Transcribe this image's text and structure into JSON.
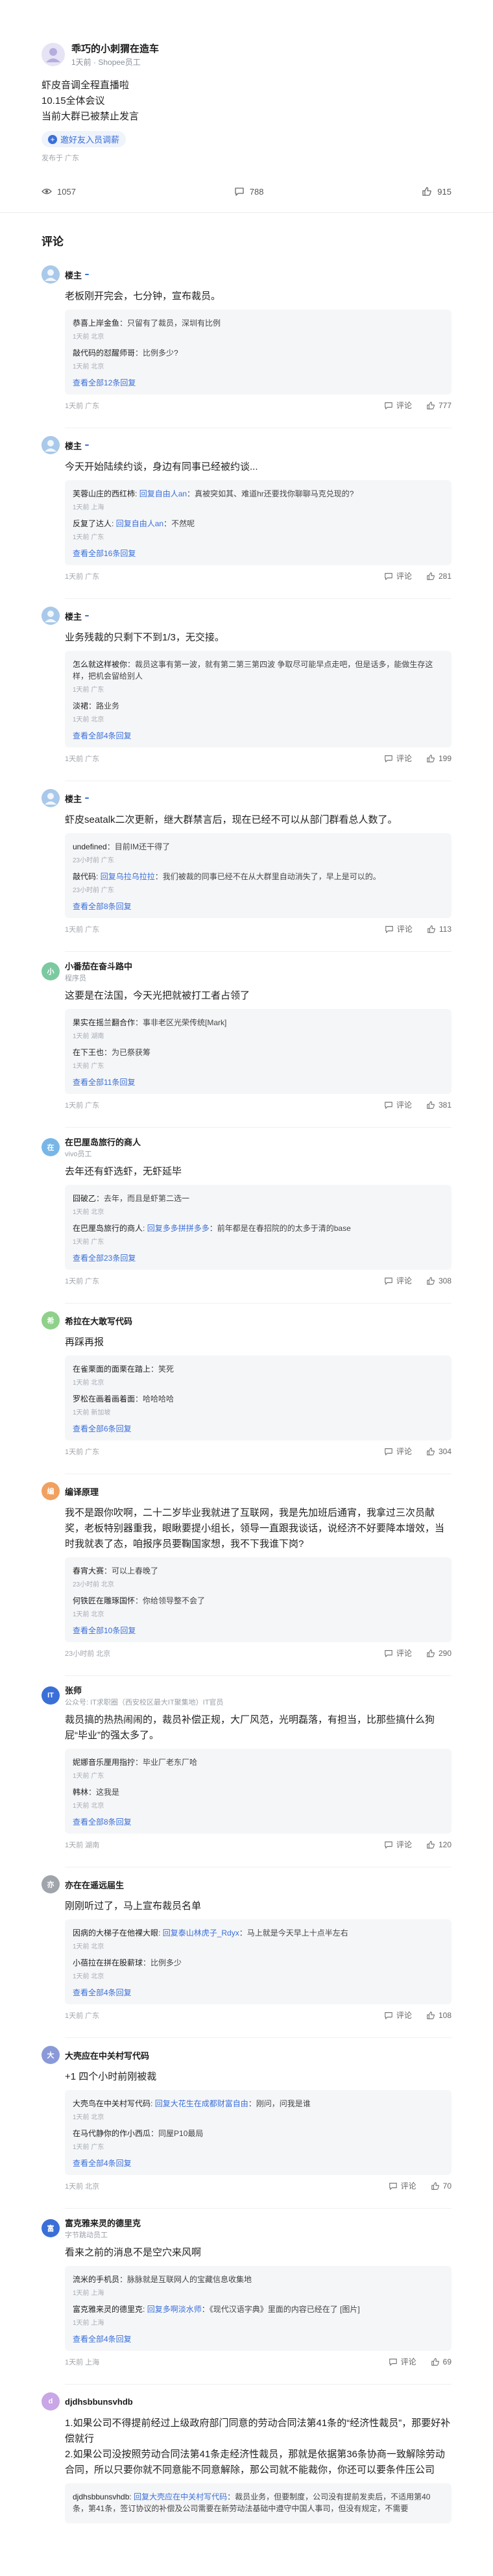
{
  "post": {
    "author": "乖巧的小刺猬在造车",
    "author_sub": "1天前 · Shopee员工",
    "lines": [
      "虾皮音调全程直播啦",
      "10.15全体会议",
      "当前大群已被禁止发言"
    ],
    "invite_label": "邀好友入员调薪",
    "meta": "发布于 广东",
    "stats": {
      "views": "1057",
      "comments": "788",
      "likes": "915"
    }
  },
  "comments_title": "评论",
  "comments": [
    {
      "name": "楼主",
      "op": true,
      "sub": "",
      "avatar_color": "#9cc2e6",
      "avatar_char": "",
      "text": [
        "老板刚开完会，七分钟，宣布裁员。"
      ],
      "replies": [
        {
          "author": "恭喜上岸金鱼",
          "to": "",
          "text": "只留有了裁员，深圳有比例",
          "meta": "1天前 北京"
        },
        {
          "author": "敲代码的怼醒师哥",
          "to": "",
          "text": "比例多少?",
          "meta": "1天前 北京"
        }
      ],
      "more": "查看全部12条回复",
      "meta": "1天前 广东",
      "comments": "评论",
      "likes": "777"
    },
    {
      "name": "楼主",
      "op": true,
      "sub": "",
      "avatar_color": "#9cc2e6",
      "avatar_char": "",
      "text": [
        "今天开始陆续约谈，身边有同事已经被约谈..."
      ],
      "replies": [
        {
          "author": "芙蓉山庄的西红柿",
          "to": "回复自由人an",
          "text": "真被突如其、难道hr还要找你聊聊马克兑现的?",
          "meta": "1天前 上海"
        },
        {
          "author": "反复了达人",
          "to": "回复自由人an",
          "text": "不然呢",
          "meta": "1天前 广东"
        }
      ],
      "more": "查看全部16条回复",
      "meta": "1天前 广东",
      "comments": "评论",
      "likes": "281"
    },
    {
      "name": "楼主",
      "op": true,
      "sub": "",
      "avatar_color": "#9cc2e6",
      "avatar_char": "",
      "text": [
        "业务残裁的只剩下不到1/3，无交接。"
      ],
      "replies": [
        {
          "author": "怎么就这样被你",
          "to": "",
          "text": "裁员这事有第一波，就有第二第三第四波 争取尽可能早点走吧，但是话多，能做生存这样，把机会留给别人",
          "meta": "1天前 广东"
        },
        {
          "author": "淡裙",
          "to": "",
          "text": "路业务",
          "meta": "1天前 北京"
        }
      ],
      "more": "查看全部4条回复",
      "meta": "1天前 广东",
      "comments": "评论",
      "likes": "199"
    },
    {
      "name": "楼主",
      "op": true,
      "sub": "",
      "avatar_color": "#9cc2e6",
      "avatar_char": "",
      "text": [
        "虾皮seatalk二次更新，继大群禁言后，现在已经不可以从部门群看总人数了。"
      ],
      "replies": [
        {
          "author": "undefined",
          "to": "",
          "text": "目前IM还干得了",
          "meta": "23小时前 广东"
        },
        {
          "author": "敲代码",
          "to": "回复乌拉乌拉拉",
          "text": "我们被裁的同事已经不在从大群里自动消失了，早上是可以的。",
          "meta": "23小时前 广东"
        }
      ],
      "more": "查看全部8条回复",
      "meta": "1天前 广东",
      "comments": "评论",
      "likes": "113"
    },
    {
      "name": "小番茄在奋斗路中",
      "op": false,
      "sub": "程序员",
      "avatar_color": "#7bc9a0",
      "avatar_char": "小",
      "text": [
        "这要是在法国，今天光把就被打工者占领了"
      ],
      "replies": [
        {
          "author": "果实在摇兰翻合作",
          "to": "",
          "text": "事非老区光荣传统[Mark]",
          "meta": "1天前 湖南"
        },
        {
          "author": "在下王也",
          "to": "",
          "text": "为已祭获筹",
          "meta": "1天前 广东"
        }
      ],
      "more": "查看全部11条回复",
      "meta": "1天前 广东",
      "comments": "评论",
      "likes": "381"
    },
    {
      "name": "在巴厘岛旅行的商人",
      "op": false,
      "sub": "vivo员工",
      "avatar_color": "#79b6e8",
      "avatar_char": "在",
      "text": [
        "去年还有虾选虾，无虾延毕"
      ],
      "replies": [
        {
          "author": "囧破乙",
          "to": "",
          "text": "去年，而且是虾第二选一",
          "meta": "1天前 北京"
        },
        {
          "author": "在巴厘岛旅行的商人",
          "to": "回复多多拼拼多多",
          "text": "前年都是在春招院的的太多于清的base",
          "meta": "1天前 广东"
        }
      ],
      "more": "查看全部23条回复",
      "meta": "1天前 广东",
      "comments": "评论",
      "likes": "308"
    },
    {
      "name": "希拉在大敢写代码",
      "op": false,
      "sub": "",
      "avatar_color": "#8fd08a",
      "avatar_char": "希",
      "text": [
        "再踩再报"
      ],
      "replies": [
        {
          "author": "在雀栗面的面栗在踏上",
          "to": "",
          "text": "笑死",
          "meta": "1天前 北京"
        },
        {
          "author": "罗松在画着画着面",
          "to": "",
          "text": "哈哈哈哈",
          "meta": "1天前 新加坡"
        }
      ],
      "more": "查看全部6条回复",
      "meta": "1天前 广东",
      "comments": "评论",
      "likes": "304"
    },
    {
      "name": "编译原理",
      "op": false,
      "sub": "",
      "avatar_color": "#f0a060",
      "avatar_char": "编",
      "text": [
        "我不是跟你吹啊，二十二岁毕业我就进了互联网，我是先加班后通宵，我拿过三次员献奖，老板特别器重我，眼瞅要提小组长，领导一直跟我谈话，说经济不好要降本增效，当时我就表了态，咱报序员要鞠国家想，我不下我谁下岗?"
      ],
      "replies": [
        {
          "author": "春宵大赛",
          "to": "",
          "text": "可以上春晚了",
          "meta": "23小时前 北京"
        },
        {
          "author": "何铁匠在雕琢国怀",
          "to": "",
          "text": "你给领导整不会了",
          "meta": "1天前 北京"
        }
      ],
      "more": "查看全部10条回复",
      "meta": "23小时前 北京",
      "comments": "评论",
      "likes": "290"
    },
    {
      "name": "张师",
      "op": false,
      "sub": "公众号: IT求职圈（西安校区最大IT聚集地）IT官员",
      "avatar_color": "#3a6fd8",
      "avatar_char": "IT",
      "text": [
        "裁员搞的热热闹闹的，裁员补偿正规，大厂风范，光明磊落，有担当，比那些搞什么狗屁“毕业”的强太多了。"
      ],
      "replies": [
        {
          "author": "妮娜音乐厘用指拧",
          "to": "",
          "text": "毕业厂老东厂哈",
          "meta": "1天前 广东"
        },
        {
          "author": "韩林",
          "to": "",
          "text": "这我是",
          "meta": "1天前 北京"
        }
      ],
      "more": "查看全部8条回复",
      "meta": "1天前 湖南",
      "comments": "评论",
      "likes": "120"
    },
    {
      "name": "亦在在遥远届生",
      "op": false,
      "sub": "",
      "avatar_color": "#a0a4ab",
      "avatar_char": "亦",
      "text": [
        "刚刚听过了，马上宣布裁员名单"
      ],
      "replies": [
        {
          "author": "因病的大梯子在他裸大眼",
          "to": "回复泰山林虎子_Rdyx",
          "text": "马上就是今天早上十点半左右",
          "meta": "1天前 北京"
        },
        {
          "author": "小蓓拉在拼在股薪球",
          "to": "",
          "text": "比例多少",
          "meta": "1天前 北京"
        }
      ],
      "more": "查看全部4条回复",
      "meta": "1天前 广东",
      "comments": "评论",
      "likes": "108"
    },
    {
      "name": "大壳应在中关村写代码",
      "op": false,
      "sub": "",
      "avatar_color": "#8a9ad8",
      "avatar_char": "大",
      "text": [
        "+1 四个小时前刚被裁"
      ],
      "replies": [
        {
          "author": "大壳鸟在中关村写代码",
          "to": "回复大花生在成都财富自由",
          "text": "刚问，问我是谁",
          "meta": "1天前 北京"
        },
        {
          "author": "在马代静你的作小西瓜",
          "to": "",
          "text": "同屋P10最局",
          "meta": "1天前 广东"
        }
      ],
      "more": "查看全部4条回复",
      "meta": "1天前 北京",
      "comments": "评论",
      "likes": "70"
    },
    {
      "name": "富克雅来灵的德里克",
      "op": false,
      "sub": "字节跳动员工",
      "avatar_color": "#3a6fd8",
      "avatar_char": "富",
      "text": [
        "看来之前的消息不是空穴来风啊"
      ],
      "replies": [
        {
          "author": "流米的手机员",
          "to": "",
          "text": "脉脉就是互联网人的宝藏信息收集地",
          "meta": "1天前 上海"
        },
        {
          "author": "富克雅来灵的德里克",
          "to": "回复多啊淡水师",
          "text": "《现代汉语字典》里面的内容已经在了 [图片]",
          "meta": "1天前 上海"
        }
      ],
      "more": "查看全部4条回复",
      "meta": "1天前 上海",
      "comments": "评论",
      "likes": "69"
    },
    {
      "name": "djdhsbbunsvhdb",
      "op": false,
      "sub": "",
      "avatar_color": "#c9a6e6",
      "avatar_char": "d",
      "text": [
        "1.如果公司不得提前经过上级政府部门同意的劳动合同法第41条的“经济性裁员”，那要好补偿就行",
        "2.如果公司没按照劳动合同法第41条走经济性裁员，那就是依据第36条协商一致解除劳动合同，所以只要你就不同意能不同意解除，那公司就不能裁你，你还可以要条件压公司"
      ],
      "replies": [
        {
          "author": "djdhsbbunsvhdb",
          "to": "回复大壳应在中关村写代码",
          "text": "裁员业务，但要制度，公司没有提前发卖后，不适用第40条，第41条，签订协议的补偿及公司需要在新劳动法基础中遵守中国人事司，但没有规定，不需要",
          "meta": ""
        }
      ],
      "more": "",
      "meta": "",
      "comments": "",
      "likes": ""
    }
  ]
}
